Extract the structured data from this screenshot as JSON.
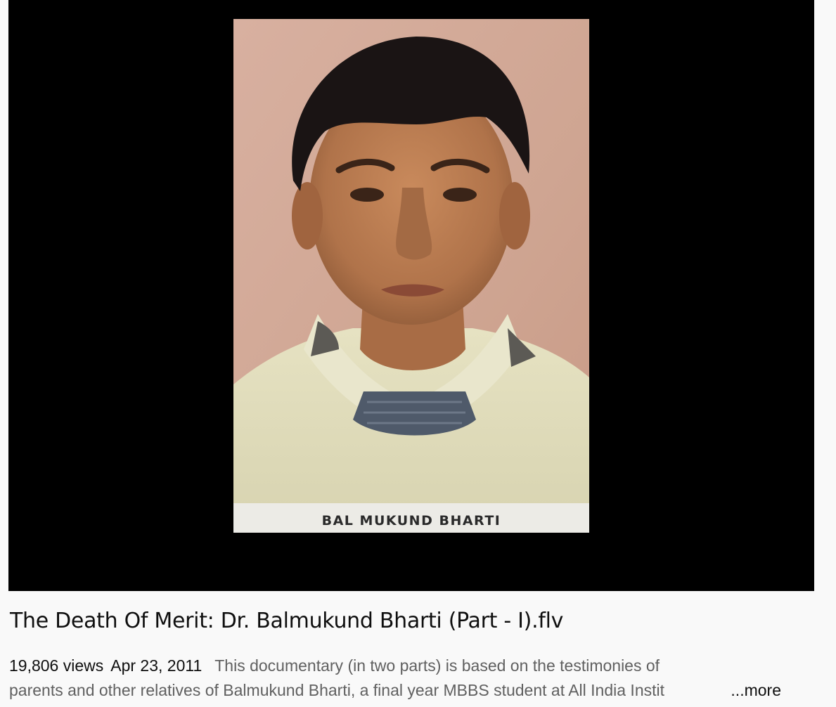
{
  "video": {
    "caption_in_frame": "BAL MUKUND BHARTI"
  },
  "title": "The Death Of Merit: Dr. Balmukund Bharti (Part - I).flv",
  "meta": {
    "views": "19,806 views",
    "date": "Apr 23, 2011"
  },
  "description": {
    "line1": "This documentary (in two parts) is based on the testimonies of",
    "line2": "parents and other relatives of Balmukund Bharti, a final year MBBS student at All India Instit",
    "more_label": "...more"
  }
}
